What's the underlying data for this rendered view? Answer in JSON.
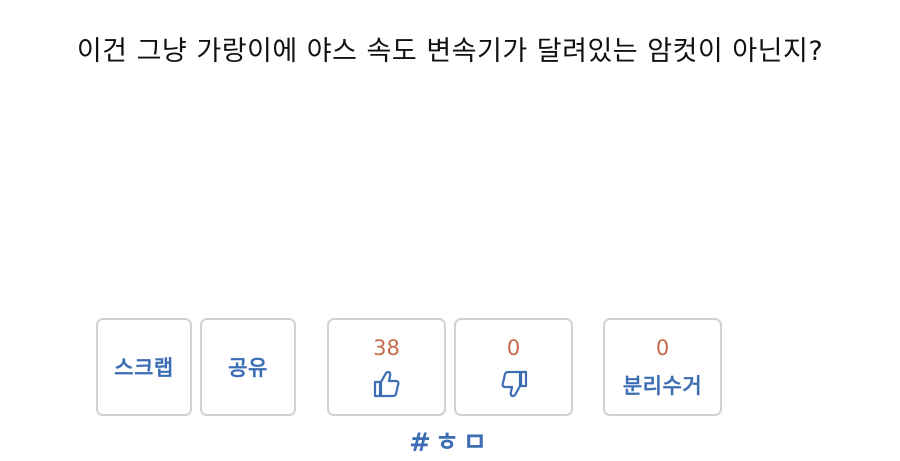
{
  "post": {
    "text": "이건 그냥 가랑이에 야스 속도 변속기가 달려있는 암컷이 아닌지?"
  },
  "actions": {
    "scrap_label": "스크랩",
    "share_label": "공유",
    "upvote_count": "38",
    "downvote_count": "0",
    "recycle_count": "0",
    "recycle_label": "분리수거",
    "upvote_icon": "thumbs-up-icon",
    "downvote_icon": "thumbs-down-icon"
  },
  "hashtag": "#ㅎㅁ",
  "colors": {
    "accent_blue": "#3d6eb4",
    "count_orange": "#c86a4a",
    "border_gray": "#d2d2d2"
  }
}
